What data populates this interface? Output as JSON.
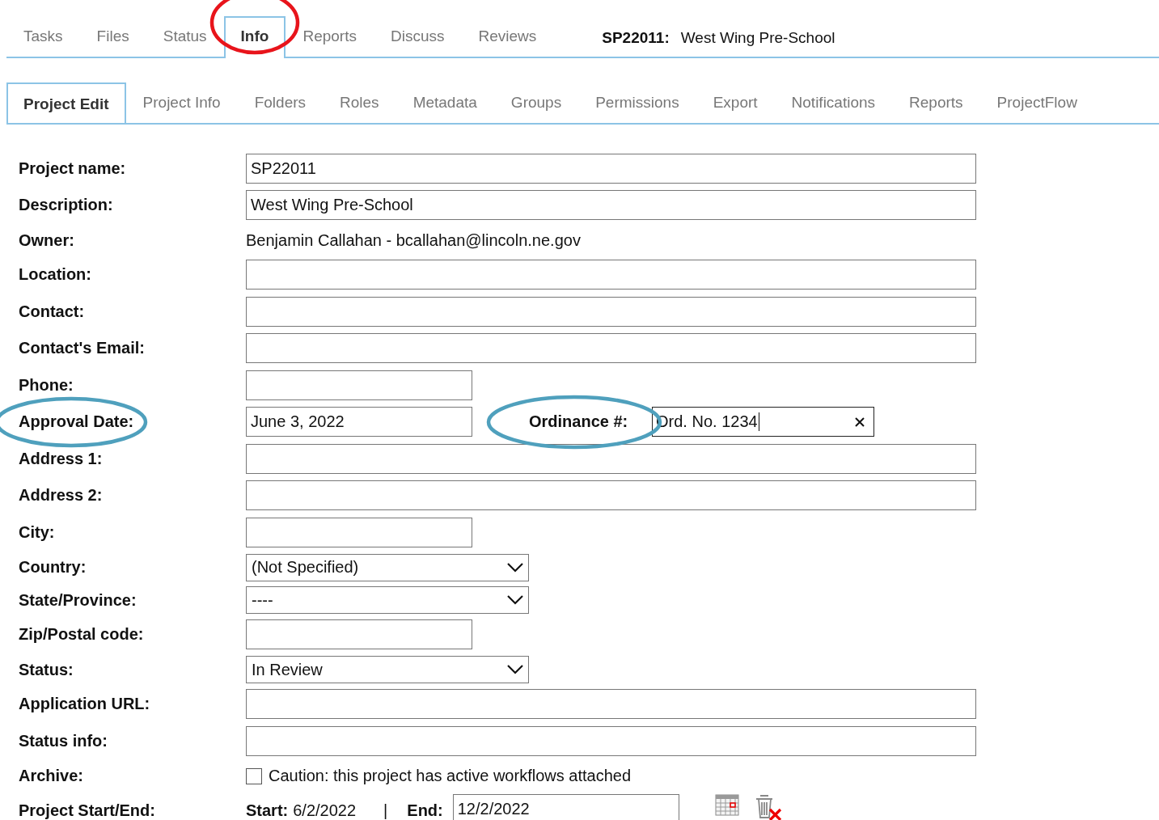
{
  "top_tabs": [
    {
      "label": "Tasks",
      "selected": false
    },
    {
      "label": "Files",
      "selected": false
    },
    {
      "label": "Status",
      "selected": false
    },
    {
      "label": "Info",
      "selected": true,
      "circled": true
    },
    {
      "label": "Reports",
      "selected": false
    },
    {
      "label": "Discuss",
      "selected": false
    },
    {
      "label": "Reviews",
      "selected": false
    }
  ],
  "project_title": {
    "code": "SP22011:",
    "name": "West Wing Pre-School"
  },
  "sub_tabs": [
    {
      "label": "Project Edit",
      "selected": true
    },
    {
      "label": "Project Info",
      "selected": false
    },
    {
      "label": "Folders",
      "selected": false
    },
    {
      "label": "Roles",
      "selected": false
    },
    {
      "label": "Metadata",
      "selected": false
    },
    {
      "label": "Groups",
      "selected": false
    },
    {
      "label": "Permissions",
      "selected": false
    },
    {
      "label": "Export",
      "selected": false
    },
    {
      "label": "Notifications",
      "selected": false
    },
    {
      "label": "Reports",
      "selected": false
    },
    {
      "label": "ProjectFlow",
      "selected": false
    }
  ],
  "fields": [
    {
      "kind": "text",
      "label": "Project name:",
      "value": "SP22011"
    },
    {
      "kind": "text",
      "label": "Description:",
      "value": "West Wing Pre-School"
    },
    {
      "kind": "static",
      "label": "Owner:",
      "value": "Benjamin Callahan - bcallahan@lincoln.ne.gov"
    },
    {
      "kind": "text",
      "label": "Location:"
    },
    {
      "kind": "text",
      "label": "Contact:"
    },
    {
      "kind": "text",
      "label": "Contact's Email:"
    },
    {
      "kind": "short",
      "label": "Phone:"
    },
    {
      "kind": "date_ordinance",
      "label": "Approval Date:",
      "value": "June 3, 2022",
      "circled": true,
      "ordinance_label": "Ordinance #:",
      "ordinance_value": "Ord. No. 1234",
      "ordinance_circled": true
    },
    {
      "kind": "text",
      "label": "Address 1:"
    },
    {
      "kind": "text",
      "label": "Address 2:"
    },
    {
      "kind": "short",
      "label": "City:"
    },
    {
      "kind": "select",
      "label": "Country:",
      "value": "(Not Specified)"
    },
    {
      "kind": "select",
      "label": "State/Province:",
      "value": "----"
    },
    {
      "kind": "short",
      "label": "Zip/Postal code:"
    },
    {
      "kind": "select",
      "label": "Status:",
      "value": "In Review"
    },
    {
      "kind": "text",
      "label": "Application URL:"
    },
    {
      "kind": "text",
      "label": "Status info:"
    },
    {
      "kind": "checkbox",
      "label": "Archive:",
      "checked": false,
      "value": "Caution: this project has active workflows attached"
    },
    {
      "kind": "start_end",
      "label": "Project Start/End:",
      "start_label": "Start:",
      "start_value": "6/2/2022",
      "separator": "|",
      "end_label": "End:",
      "end_value": "12/2/2022"
    }
  ]
}
